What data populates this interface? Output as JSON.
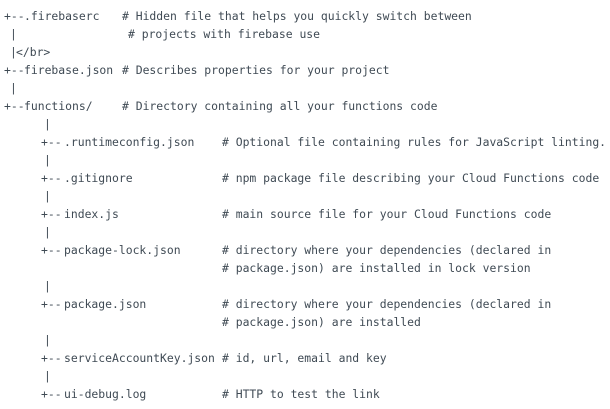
{
  "tree": [
    {
      "branch": "+-- ",
      "name": ".firebaserc",
      "comment": "# Hidden file that helps you quickly switch between"
    },
    {
      "pipe": "|",
      "comment": "# projects with firebase use"
    },
    {
      "pipe": "|",
      "name": "</br>"
    },
    {
      "branch": "+-- ",
      "name": "firebase.json",
      "comment": "# Describes properties for your project"
    },
    {
      "pipe": "|"
    },
    {
      "branch": "+-- ",
      "name": "functions/",
      "comment": "# Directory containing all your functions code"
    },
    {
      "pipe": "|"
    },
    {
      "branch": "+-- ",
      "name": ".runtimeconfig.json",
      "comment": "# Optional file containing rules for JavaScript linting."
    },
    {
      "pipe": "|"
    },
    {
      "branch": "+-- ",
      "name": ".gitignore",
      "comment": "# npm package file describing your Cloud Functions code"
    },
    {
      "pipe": "|"
    },
    {
      "branch": "+-- ",
      "name": "index.js",
      "comment": "# main source file for your Cloud Functions code"
    },
    {
      "pipe": "|"
    },
    {
      "branch": "+-- ",
      "name": "package-lock.json",
      "comment": "# directory where your dependencies (declared in"
    },
    {
      "comment": "# package.json) are installed in lock version"
    },
    {
      "pipe": "|"
    },
    {
      "branch": "+-- ",
      "name": "package.json",
      "comment": "# directory where your dependencies (declared in"
    },
    {
      "comment": "# package.json) are installed"
    },
    {
      "pipe": "|"
    },
    {
      "branch": "+-- ",
      "name": "serviceAccountKey.json",
      "comment": "# id, url, email and key"
    },
    {
      "pipe": "|"
    },
    {
      "branch": "+-- ",
      "name": "ui-debug.log",
      "comment": "# HTTP to test the link"
    }
  ]
}
